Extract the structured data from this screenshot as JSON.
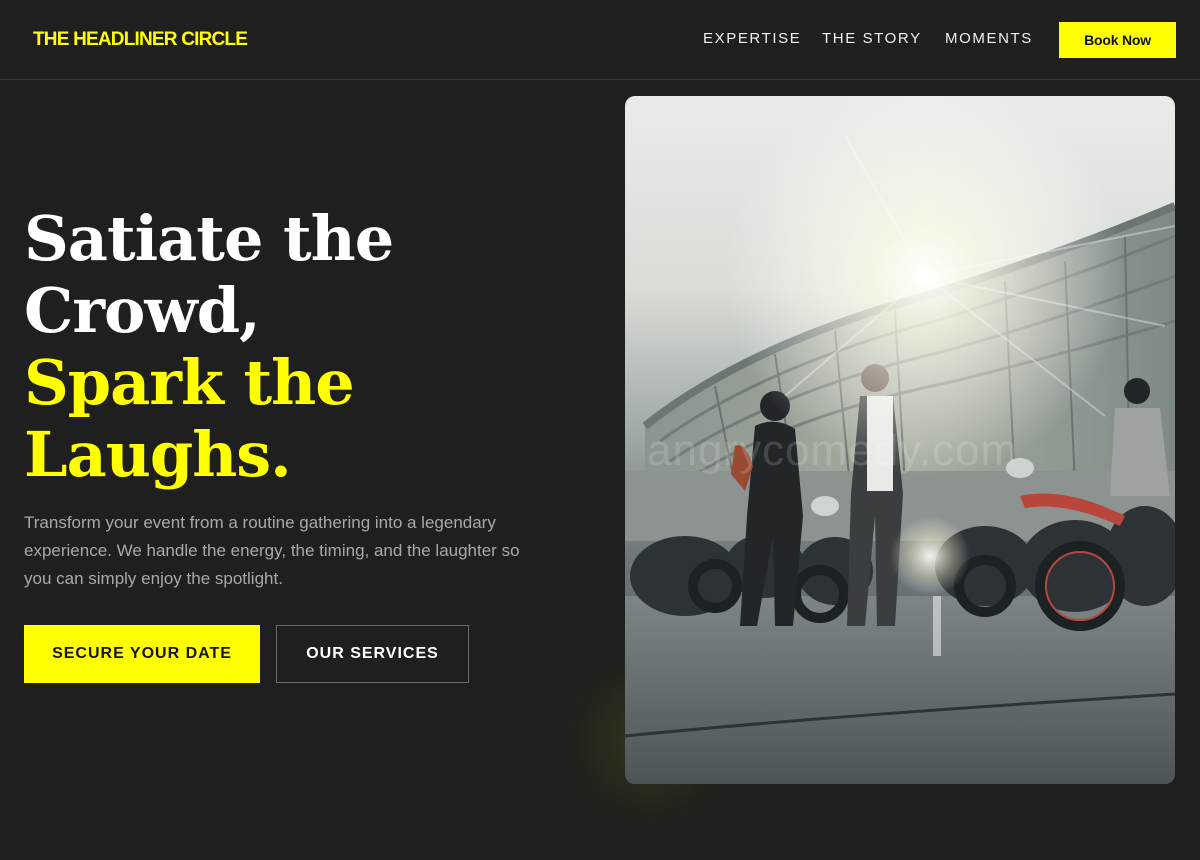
{
  "header": {
    "logo": "THE HEADLINER CIRCLE",
    "nav": [
      "EXPERTISE",
      "THE STORY",
      "MOMENTS"
    ],
    "book_label": "Book Now"
  },
  "hero": {
    "headline_white": [
      "Satiate the",
      "Crowd,"
    ],
    "headline_yellow": [
      "Spark the",
      "Laughs."
    ],
    "lead": "Transform your event from a routine gathering into a legendary experience. We handle the energy, the timing, and the laughter so you can simply enjoy the spotlight.",
    "primary_cta": "SECURE YOUR DATE",
    "secondary_cta": "OUR SERVICES"
  },
  "image": {
    "watermark": "angrycomedy.com"
  },
  "colors": {
    "accent": "#ffff00",
    "background": "#1f1f1f",
    "text_muted": "#a9a9ad"
  }
}
